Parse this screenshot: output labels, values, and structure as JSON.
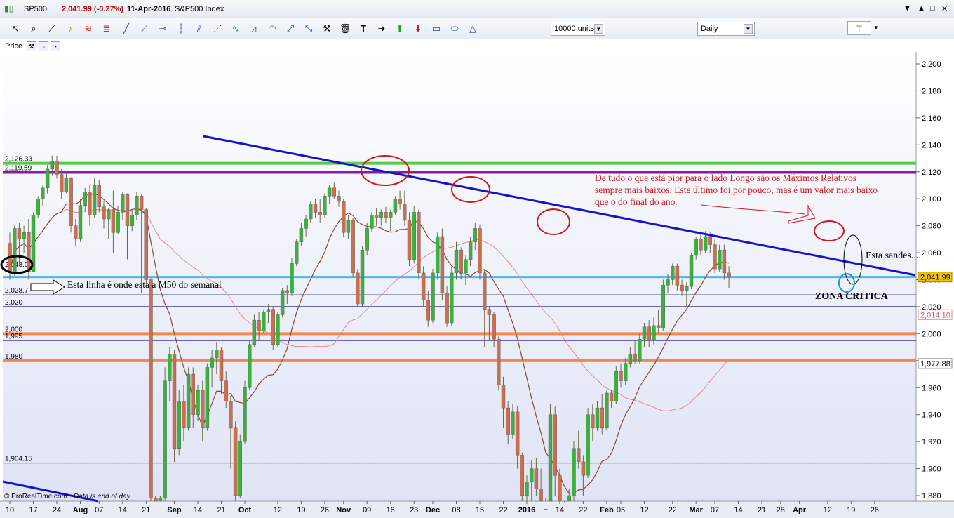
{
  "window": {
    "symbol": "SP500",
    "change": "2,041.99 (-0.27%)",
    "date": "11-Apr-2016",
    "name": "S&P500 Index",
    "controls": [
      "▼",
      "▲",
      "□",
      "✕"
    ]
  },
  "toolbar": {
    "units_value": "10000 units",
    "period_value": "Daily"
  },
  "panel": {
    "label": "Price"
  },
  "footer": {
    "source": "© ProRealTime.com",
    "note": "Data is end of day"
  },
  "colors": {
    "up": "#3db03d",
    "down": "#c87050",
    "green_line": "#55cc44",
    "purple_line": "#8a1aa6",
    "blue_trend": "#1414c8",
    "cyan_line": "#48b8e8",
    "navy_line": "#1a1a80",
    "orange_line": "#f08850",
    "ma_brown": "#8a4a30",
    "ma_pink": "#e08a8a",
    "red_annot": "#d01818",
    "price_label_bg": "#f2c400"
  },
  "chart_data": {
    "type": "candlestick",
    "title": "S&P500 Index",
    "y_range": [
      1875,
      2210
    ],
    "y_ticks": [
      1880,
      1900,
      1920,
      1940,
      1960,
      1980,
      2000,
      2020,
      2040,
      2060,
      2080,
      2100,
      2120,
      2140,
      2160,
      2180,
      2200
    ],
    "y_tick_labels": [
      "1,880",
      "1,900",
      "1,920",
      "1,940",
      "1,960",
      "1,980",
      "2,000",
      "2,020",
      "2,040",
      "2,060",
      "2,080",
      "2,100",
      "2,120",
      "2,140",
      "2,160",
      "2,180",
      "2,200"
    ],
    "x_ticks": [
      {
        "label": "10",
        "bar": 0
      },
      {
        "label": "17",
        "bar": 5
      },
      {
        "label": "24",
        "bar": 10
      },
      {
        "label": "Aug",
        "bar": 15,
        "bold": true
      },
      {
        "label": "07",
        "bar": 19
      },
      {
        "label": "14",
        "bar": 24
      },
      {
        "label": "21",
        "bar": 29
      },
      {
        "label": "Sep",
        "bar": 35,
        "bold": true
      },
      {
        "label": "14",
        "bar": 40
      },
      {
        "label": "21",
        "bar": 45
      },
      {
        "label": "Oct",
        "bar": 50,
        "bold": true
      },
      {
        "label": "12",
        "bar": 57
      },
      {
        "label": "19",
        "bar": 62
      },
      {
        "label": "26",
        "bar": 67
      },
      {
        "label": "Nov",
        "bar": 71,
        "bold": true
      },
      {
        "label": "09",
        "bar": 76
      },
      {
        "label": "16",
        "bar": 81
      },
      {
        "label": "23",
        "bar": 86
      },
      {
        "label": "Dec",
        "bar": 90,
        "bold": true
      },
      {
        "label": "08",
        "bar": 95
      },
      {
        "label": "15",
        "bar": 100
      },
      {
        "label": "22",
        "bar": 105
      },
      {
        "label": "2016",
        "bar": 110,
        "bold": true
      },
      {
        "label": "14",
        "bar": 117
      },
      {
        "label": "22",
        "bar": 122
      },
      {
        "label": "Feb",
        "bar": 127,
        "bold": true
      },
      {
        "label": "05",
        "bar": 130
      },
      {
        "label": "12",
        "bar": 135
      },
      {
        "label": "22",
        "bar": 141
      },
      {
        "label": "Mar",
        "bar": 146,
        "bold": true
      },
      {
        "label": "07",
        "bar": 150
      },
      {
        "label": "14",
        "bar": 155
      },
      {
        "label": "21",
        "bar": 160
      },
      {
        "label": "28",
        "bar": 164
      },
      {
        "label": "Apr",
        "bar": 168,
        "bold": true
      },
      {
        "label": "12",
        "bar": 174
      },
      {
        "label": "19",
        "bar": 179
      },
      {
        "label": "26",
        "bar": 184
      }
    ],
    "candles": [
      [
        2067,
        2075,
        2040,
        2045
      ],
      [
        2045,
        2080,
        2043,
        2078
      ],
      [
        2078,
        2082,
        2050,
        2070
      ],
      [
        2070,
        2080,
        2060,
        2075
      ],
      [
        2075,
        2085,
        2040,
        2046
      ],
      [
        2046,
        2090,
        2046,
        2088
      ],
      [
        2088,
        2102,
        2086,
        2100
      ],
      [
        2100,
        2110,
        2095,
        2108
      ],
      [
        2108,
        2125,
        2104,
        2122
      ],
      [
        2122,
        2132,
        2117,
        2128
      ],
      [
        2128,
        2132,
        2115,
        2118
      ],
      [
        2118,
        2122,
        2100,
        2105
      ],
      [
        2105,
        2120,
        2104,
        2115
      ],
      [
        2115,
        2116,
        2075,
        2080
      ],
      [
        2080,
        2085,
        2065,
        2070
      ],
      [
        2070,
        2100,
        2068,
        2095
      ],
      [
        2095,
        2108,
        2090,
        2105
      ],
      [
        2105,
        2110,
        2080,
        2088
      ],
      [
        2088,
        2115,
        2086,
        2110
      ],
      [
        2110,
        2114,
        2090,
        2094
      ],
      [
        2094,
        2098,
        2078,
        2085
      ],
      [
        2085,
        2093,
        2070,
        2092
      ],
      [
        2092,
        2106,
        2060,
        2075
      ],
      [
        2075,
        2095,
        2074,
        2090
      ],
      [
        2090,
        2105,
        2084,
        2103
      ],
      [
        2103,
        2104,
        2055,
        2080
      ],
      [
        2080,
        2092,
        2076,
        2088
      ],
      [
        2088,
        2105,
        2084,
        2102
      ],
      [
        2102,
        2103,
        2030,
        2092
      ],
      [
        2092,
        2093,
        2035,
        2040
      ],
      [
        2040,
        2041,
        1870,
        1878
      ],
      [
        1878,
        1880,
        1870,
        1875
      ],
      [
        1875,
        1880,
        1870,
        1878
      ],
      [
        1878,
        1975,
        1875,
        1965
      ],
      [
        1965,
        1990,
        1950,
        1985
      ],
      [
        1985,
        1988,
        1905,
        1915
      ],
      [
        1915,
        1958,
        1910,
        1950
      ],
      [
        1950,
        1962,
        1920,
        1930
      ],
      [
        1930,
        1975,
        1928,
        1970
      ],
      [
        1970,
        1975,
        1930,
        1940
      ],
      [
        1940,
        1962,
        1935,
        1958
      ],
      [
        1958,
        1965,
        1920,
        1930
      ],
      [
        1930,
        1978,
        1928,
        1975
      ],
      [
        1975,
        1988,
        1960,
        1982
      ],
      [
        1982,
        1994,
        1970,
        1988
      ],
      [
        1988,
        1990,
        1955,
        1965
      ],
      [
        1965,
        1972,
        1945,
        1950
      ],
      [
        1950,
        1954,
        1900,
        1930
      ],
      [
        1930,
        1935,
        1875,
        1880
      ],
      [
        1880,
        1925,
        1878,
        1920
      ],
      [
        1920,
        1965,
        1918,
        1960
      ],
      [
        1960,
        1995,
        1958,
        1992
      ],
      [
        1992,
        2014,
        1990,
        2010
      ],
      [
        2010,
        2016,
        1995,
        2002
      ],
      [
        2002,
        2018,
        2000,
        2016
      ],
      [
        2016,
        2022,
        2008,
        2018
      ],
      [
        2018,
        2020,
        1988,
        1992
      ],
      [
        1992,
        2016,
        1990,
        2014
      ],
      [
        2014,
        2034,
        2012,
        2032
      ],
      [
        2032,
        2036,
        2022,
        2030
      ],
      [
        2030,
        2056,
        2028,
        2052
      ],
      [
        2052,
        2070,
        2050,
        2068
      ],
      [
        2068,
        2082,
        2065,
        2078
      ],
      [
        2078,
        2088,
        2072,
        2085
      ],
      [
        2085,
        2098,
        2082,
        2096
      ],
      [
        2096,
        2100,
        2086,
        2090
      ],
      [
        2090,
        2100,
        2082,
        2088
      ],
      [
        2088,
        2104,
        2086,
        2102
      ],
      [
        2102,
        2110,
        2096,
        2108
      ],
      [
        2108,
        2112,
        2100,
        2102
      ],
      [
        2102,
        2106,
        2094,
        2098
      ],
      [
        2098,
        2100,
        2072,
        2075
      ],
      [
        2075,
        2088,
        2070,
        2084
      ],
      [
        2084,
        2086,
        2042,
        2045
      ],
      [
        2045,
        2048,
        2020,
        2022
      ],
      [
        2022,
        2065,
        2020,
        2062
      ],
      [
        2062,
        2082,
        2058,
        2078
      ],
      [
        2078,
        2090,
        2075,
        2088
      ],
      [
        2088,
        2093,
        2080,
        2086
      ],
      [
        2086,
        2092,
        2080,
        2090
      ],
      [
        2090,
        2094,
        2082,
        2086
      ],
      [
        2086,
        2092,
        2076,
        2090
      ],
      [
        2090,
        2102,
        2088,
        2100
      ],
      [
        2100,
        2106,
        2092,
        2096
      ],
      [
        2096,
        2106,
        2080,
        2084
      ],
      [
        2084,
        2090,
        2050,
        2055
      ],
      [
        2055,
        2095,
        2052,
        2090
      ],
      [
        2090,
        2092,
        2040,
        2045
      ],
      [
        2045,
        2050,
        2020,
        2025
      ],
      [
        2025,
        2032,
        2005,
        2010
      ],
      [
        2010,
        2048,
        2008,
        2045
      ],
      [
        2045,
        2075,
        2040,
        2072
      ],
      [
        2072,
        2078,
        2025,
        2030
      ],
      [
        2030,
        2035,
        2005,
        2008
      ],
      [
        2008,
        2050,
        2006,
        2045
      ],
      [
        2045,
        2068,
        2040,
        2062
      ],
      [
        2062,
        2064,
        2040,
        2045
      ],
      [
        2045,
        2058,
        2036,
        2055
      ],
      [
        2055,
        2072,
        2050,
        2068
      ],
      [
        2068,
        2082,
        2062,
        2078
      ],
      [
        2078,
        2081,
        2040,
        2045
      ],
      [
        2045,
        2047,
        1990,
        2018
      ],
      [
        2018,
        2020,
        1995,
        2014
      ],
      [
        2014,
        2016,
        1990,
        1996
      ],
      [
        1996,
        1998,
        1958,
        1962
      ],
      [
        1962,
        1968,
        1930,
        1945
      ],
      [
        1945,
        1950,
        1918,
        1925
      ],
      [
        1925,
        1948,
        1922,
        1942
      ],
      [
        1942,
        1946,
        1900,
        1910
      ],
      [
        1910,
        1912,
        1868,
        1880
      ],
      [
        1880,
        1895,
        1865,
        1890
      ],
      [
        1890,
        1906,
        1872,
        1900
      ],
      [
        1900,
        1908,
        1880,
        1885
      ],
      [
        1885,
        1900,
        1860,
        1870
      ],
      [
        1870,
        1878,
        1832,
        1840
      ],
      [
        1840,
        1948,
        1838,
        1940
      ],
      [
        1940,
        1946,
        1880,
        1895
      ],
      [
        1895,
        1900,
        1852,
        1860
      ],
      [
        1860,
        1875,
        1820,
        1830
      ],
      [
        1830,
        1885,
        1828,
        1880
      ],
      [
        1880,
        1920,
        1876,
        1915
      ],
      [
        1915,
        1928,
        1900,
        1905
      ],
      [
        1905,
        1910,
        1880,
        1895
      ],
      [
        1895,
        1945,
        1893,
        1940
      ],
      [
        1940,
        1948,
        1920,
        1930
      ],
      [
        1930,
        1950,
        1928,
        1945
      ],
      [
        1945,
        1955,
        1925,
        1930
      ],
      [
        1930,
        1958,
        1928,
        1956
      ],
      [
        1956,
        1958,
        1945,
        1950
      ],
      [
        1950,
        1976,
        1948,
        1972
      ],
      [
        1972,
        1978,
        1960,
        1965
      ],
      [
        1965,
        1982,
        1962,
        1978
      ],
      [
        1978,
        1990,
        1975,
        1985
      ],
      [
        1985,
        1995,
        1978,
        1980
      ],
      [
        1980,
        2000,
        1978,
        1996
      ],
      [
        1996,
        2008,
        1990,
        2005
      ],
      [
        2005,
        2010,
        1990,
        1995
      ],
      [
        1995,
        2012,
        1992,
        2006
      ],
      [
        2006,
        2018,
        2000,
        2004
      ],
      [
        2004,
        2040,
        2002,
        2036
      ],
      [
        2036,
        2044,
        2030,
        2040
      ],
      [
        2040,
        2052,
        2036,
        2050
      ],
      [
        2050,
        2052,
        2032,
        2036
      ],
      [
        2036,
        2040,
        2028,
        2032
      ],
      [
        2032,
        2038,
        2020,
        2035
      ],
      [
        2035,
        2060,
        2033,
        2058
      ],
      [
        2058,
        2072,
        2055,
        2070
      ],
      [
        2070,
        2074,
        2058,
        2062
      ],
      [
        2062,
        2076,
        2060,
        2072
      ],
      [
        2072,
        2075,
        2060,
        2066
      ],
      [
        2066,
        2070,
        2045,
        2048
      ],
      [
        2048,
        2066,
        2046,
        2062
      ],
      [
        2062,
        2066,
        2040,
        2045
      ],
      [
        2045,
        2050,
        2034,
        2042
      ]
    ],
    "indicator_ma_short": {
      "name": "",
      "color": "#8a4a30"
    },
    "indicator_ma_long": {
      "name": "",
      "color": "#e08a8a"
    },
    "horizontal_levels": [
      {
        "value": 2126.33,
        "label": "2,126.33",
        "color": "green"
      },
      {
        "value": 2119.59,
        "label": "2,119.59",
        "color": "purple"
      },
      {
        "value": 2048.0,
        "label": "2,048.00",
        "color": "black"
      },
      {
        "value": 2041.99,
        "label": "",
        "color": "cyan"
      },
      {
        "value": 2028.7,
        "label": "2,028.7",
        "color": "navy"
      },
      {
        "value": 2020,
        "label": "2,020",
        "color": "navy"
      },
      {
        "value": 2000,
        "label": "2,000",
        "color": "orange"
      },
      {
        "value": 1995,
        "label": "1,995",
        "color": "navy"
      },
      {
        "value": 1980,
        "label": "1,980",
        "color": "orange"
      },
      {
        "value": 1904.15,
        "label": "1,904.15",
        "color": "black"
      }
    ],
    "price_labels": [
      {
        "value": 2041.99,
        "label": "2,041.99",
        "style": "current"
      },
      {
        "value": 2014.1,
        "label": "2,014.10",
        "style": "pink"
      },
      {
        "value": 1977.88,
        "label": "1,977.88",
        "style": "plain"
      }
    ],
    "annotations": {
      "text_main": "De tudo o que está pior para o lado Longo são os Máximos Relativos sempre mais baixos. Este último foi por pouco, mas é um valor mais baixo que o do final do ano.",
      "text_main_lines": [
        "De tudo o que está pior para o lado Longo são os Máximos Relativos",
        "sempre mais baixos. Este último foi por pouco, mas é um valor mais baixo",
        "que o do final do ano."
      ],
      "esta_linha": "Esta linha é onde esta a M50 do semanal",
      "esta_sandes": "Esta sandes.....",
      "zona_critica": "ZONA CRITICA"
    }
  }
}
